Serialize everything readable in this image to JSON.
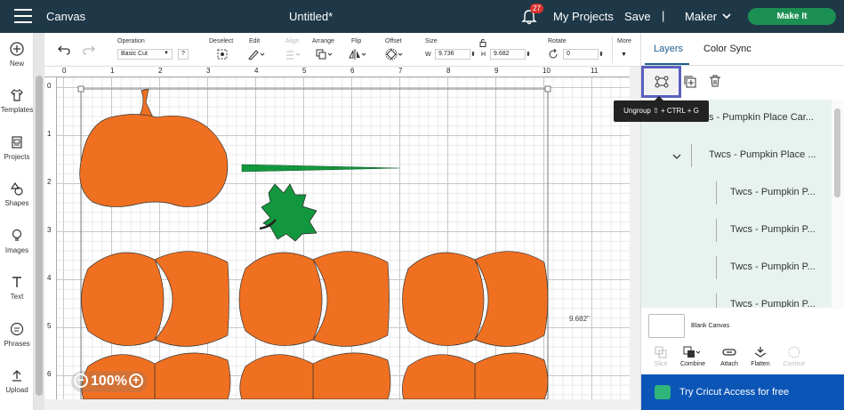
{
  "topbar": {
    "app_title": "Canvas",
    "doc_title": "Untitled*",
    "notifications": "27",
    "my_projects": "My Projects",
    "save": "Save",
    "separator": "|",
    "machine": "Maker",
    "make_it": "Make It"
  },
  "leftbar": {
    "items": [
      {
        "label": "New",
        "icon": "plus-circle-icon"
      },
      {
        "label": "Templates",
        "icon": "shirt-icon"
      },
      {
        "label": "Projects",
        "icon": "projects-icon"
      },
      {
        "label": "Shapes",
        "icon": "shapes-icon"
      },
      {
        "label": "Images",
        "icon": "bulb-icon"
      },
      {
        "label": "Text",
        "icon": "text-icon"
      },
      {
        "label": "Phrases",
        "icon": "phrases-icon"
      },
      {
        "label": "Upload",
        "icon": "upload-icon"
      }
    ]
  },
  "toolbar": {
    "operation_label": "Operation",
    "operation_value": "Basic Cut",
    "help": "?",
    "deselect": "Deselect",
    "edit": "Edit",
    "align": "Align",
    "arrange": "Arrange",
    "flip": "Flip",
    "offset": "Offset",
    "size": "Size",
    "w_label": "W",
    "w_value": "9.736",
    "h_label": "H",
    "h_value": "9.682",
    "rotate": "Rotate",
    "rotate_value": "0",
    "more": "More"
  },
  "ruler": {
    "top": [
      "0",
      "1",
      "2",
      "3",
      "4",
      "5",
      "6",
      "7",
      "8",
      "9",
      "10",
      "11"
    ],
    "left": [
      "0",
      "1",
      "2",
      "3",
      "4",
      "5",
      "6"
    ]
  },
  "canvas": {
    "zoom": "100%",
    "dimension": "9.682\""
  },
  "panel": {
    "tab_layers": "Layers",
    "tab_color_sync": "Color Sync",
    "tooltip": "Ungroup ⇧ + CTRL + G",
    "layers": [
      {
        "label": "s - Pumpkin Place Car..."
      },
      {
        "label": "Twcs - Pumpkin Place ..."
      },
      {
        "label": "Twcs - Pumpkin P..."
      },
      {
        "label": "Twcs - Pumpkin P..."
      },
      {
        "label": "Twcs - Pumpkin P..."
      },
      {
        "label": "Twcs - Pumpkin P..."
      }
    ],
    "blank_canvas": "Blank Canvas",
    "actions": {
      "slice": "Slice",
      "combine": "Combine",
      "attach": "Attach",
      "flatten": "Flatten",
      "contour": "Contour"
    },
    "access": "Try Cricut Access for free"
  },
  "colors": {
    "topbar": "#1e3848",
    "pumpkin": "#f07021",
    "leaf": "#13973e",
    "make_it": "#1c8f52",
    "access": "#0b55b7"
  }
}
